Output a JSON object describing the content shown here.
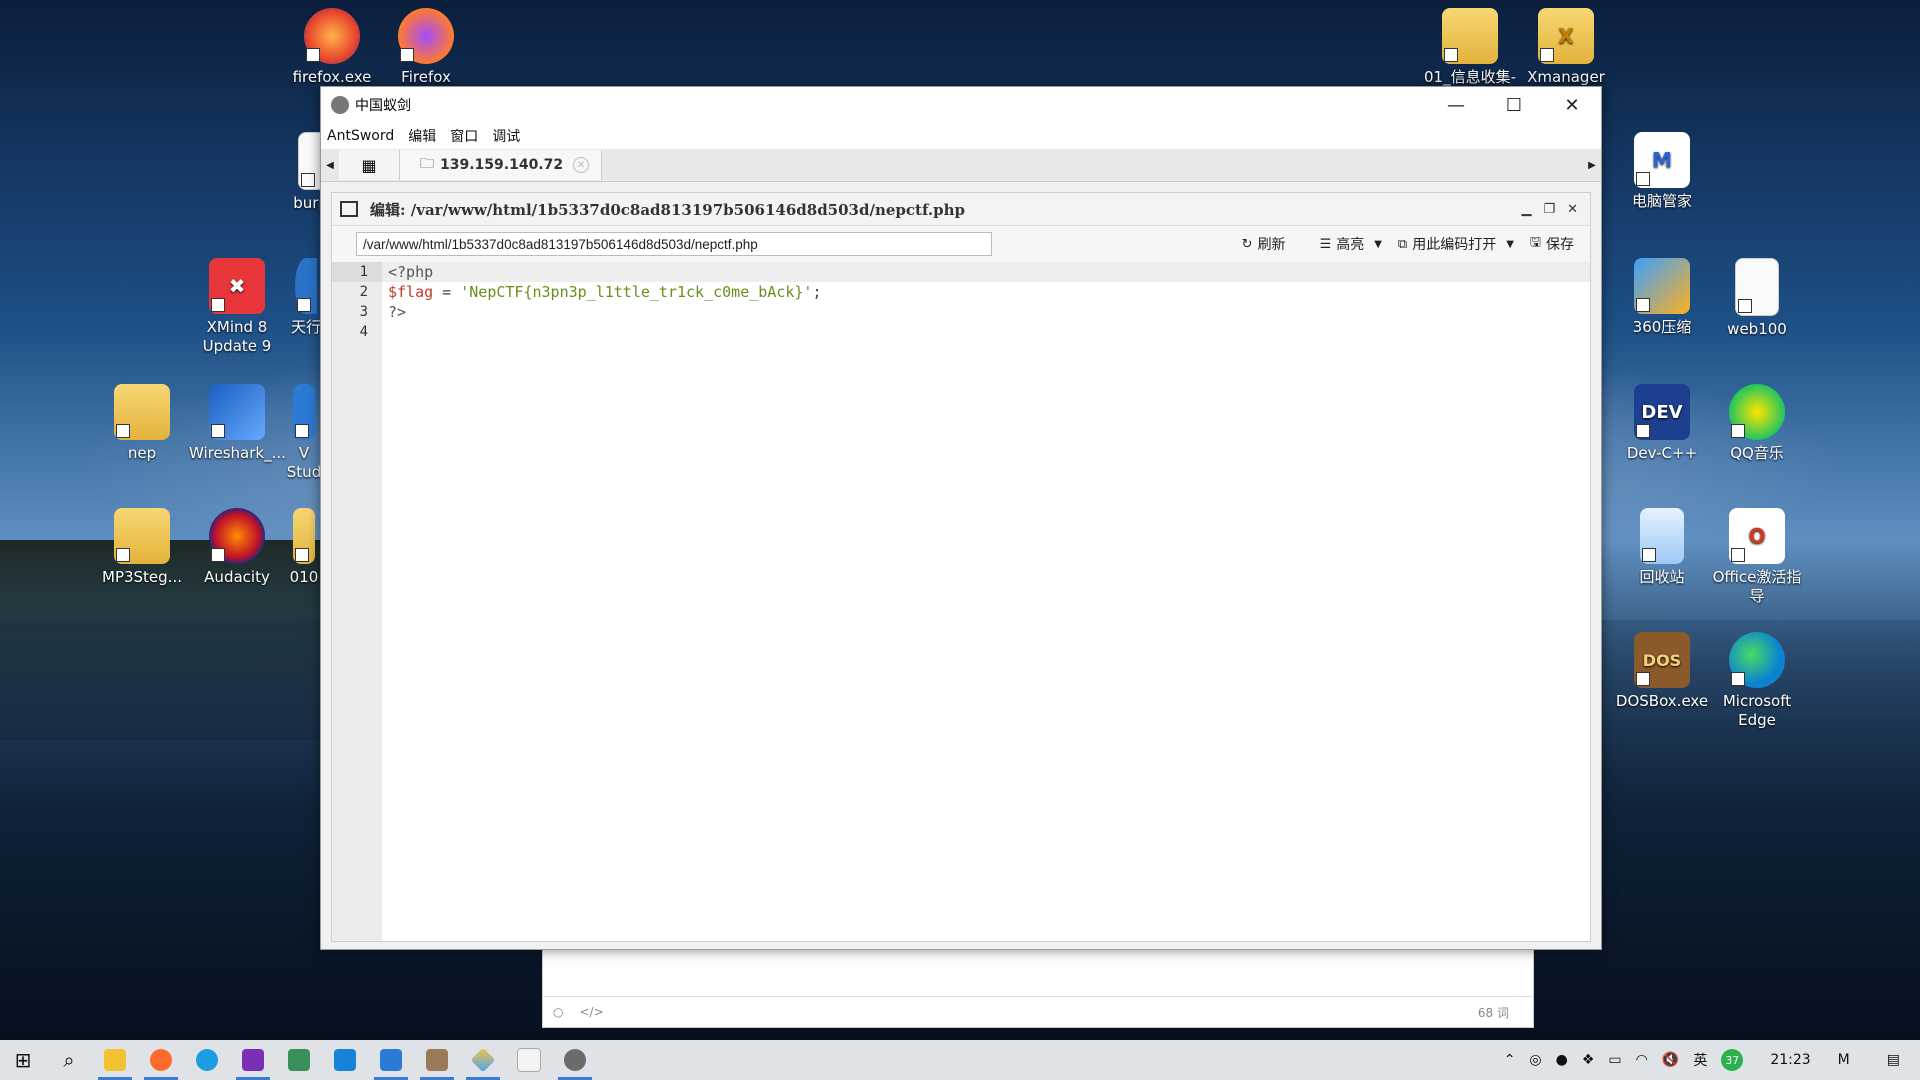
{
  "desktop": {
    "icons_top": [
      {
        "label": "firefox.exe"
      },
      {
        "label": "Firefox"
      },
      {
        "label": "01_信息收集-"
      },
      {
        "label": "Xmanager"
      }
    ],
    "icons_left": [
      {
        "label": "burp"
      },
      {
        "label": "XMind 8 Update 9"
      },
      {
        "label": "天行"
      },
      {
        "label": "nep"
      },
      {
        "label": "Wireshark_..."
      },
      {
        "label": "V Stud"
      },
      {
        "label": "MP3Steg..."
      },
      {
        "label": "Audacity"
      },
      {
        "label": "010"
      }
    ],
    "icons_right": [
      {
        "label": "电脑管家"
      },
      {
        "label": "360压缩"
      },
      {
        "label": "web100"
      },
      {
        "label": "Dev-C++"
      },
      {
        "label": "QQ音乐"
      },
      {
        "label": "回收站"
      },
      {
        "label": "Office激活指导"
      },
      {
        "label": "DOSBox.exe"
      },
      {
        "label": "Microsoft Edge"
      }
    ]
  },
  "window": {
    "title": "中国蚁剑",
    "menu": [
      "AntSword",
      "编辑",
      "窗口",
      "调试"
    ],
    "tab": {
      "label": "139.159.140.72"
    },
    "panel": {
      "title": "编辑: /var/www/html/1b5337d0c8ad813197b506146d8d503d/nepctf.php",
      "path_value": "/var/www/html/1b5337d0c8ad813197b506146d8d503d/nepctf.php",
      "buttons": {
        "refresh": "刷新",
        "highlight": "高亮",
        "open_encoding": "用此编码打开",
        "save": "保存"
      }
    },
    "editor": {
      "line_numbers": [
        "1",
        "2",
        "3",
        "4"
      ],
      "line1": "<?php",
      "line2_var": "$flag",
      "line2_op": " = ",
      "line2_str": "'NepCTF{n3pn3p_l1ttle_tr1ck_c0me_bAck}'",
      "line2_end": ";",
      "line3": "?>"
    }
  },
  "background_window": {
    "word_count": "68 词"
  },
  "taskbar": {
    "clock": "21:23",
    "ime": "英",
    "weather_badge": "37"
  }
}
